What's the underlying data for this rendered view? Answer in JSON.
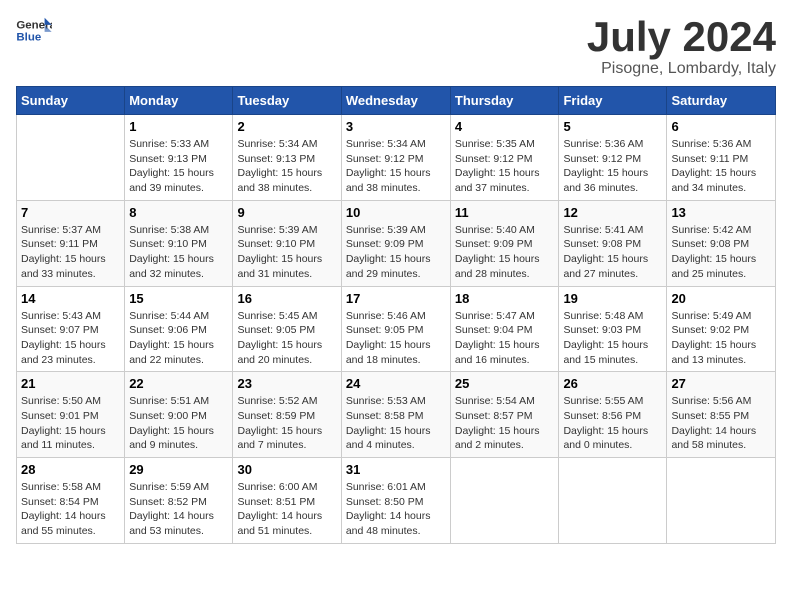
{
  "header": {
    "logo_general": "General",
    "logo_blue": "Blue",
    "month_title": "July 2024",
    "location": "Pisogne, Lombardy, Italy"
  },
  "weekdays": [
    "Sunday",
    "Monday",
    "Tuesday",
    "Wednesday",
    "Thursday",
    "Friday",
    "Saturday"
  ],
  "weeks": [
    [
      {
        "day": "",
        "info": ""
      },
      {
        "day": "1",
        "info": "Sunrise: 5:33 AM\nSunset: 9:13 PM\nDaylight: 15 hours\nand 39 minutes."
      },
      {
        "day": "2",
        "info": "Sunrise: 5:34 AM\nSunset: 9:13 PM\nDaylight: 15 hours\nand 38 minutes."
      },
      {
        "day": "3",
        "info": "Sunrise: 5:34 AM\nSunset: 9:12 PM\nDaylight: 15 hours\nand 38 minutes."
      },
      {
        "day": "4",
        "info": "Sunrise: 5:35 AM\nSunset: 9:12 PM\nDaylight: 15 hours\nand 37 minutes."
      },
      {
        "day": "5",
        "info": "Sunrise: 5:36 AM\nSunset: 9:12 PM\nDaylight: 15 hours\nand 36 minutes."
      },
      {
        "day": "6",
        "info": "Sunrise: 5:36 AM\nSunset: 9:11 PM\nDaylight: 15 hours\nand 34 minutes."
      }
    ],
    [
      {
        "day": "7",
        "info": "Sunrise: 5:37 AM\nSunset: 9:11 PM\nDaylight: 15 hours\nand 33 minutes."
      },
      {
        "day": "8",
        "info": "Sunrise: 5:38 AM\nSunset: 9:10 PM\nDaylight: 15 hours\nand 32 minutes."
      },
      {
        "day": "9",
        "info": "Sunrise: 5:39 AM\nSunset: 9:10 PM\nDaylight: 15 hours\nand 31 minutes."
      },
      {
        "day": "10",
        "info": "Sunrise: 5:39 AM\nSunset: 9:09 PM\nDaylight: 15 hours\nand 29 minutes."
      },
      {
        "day": "11",
        "info": "Sunrise: 5:40 AM\nSunset: 9:09 PM\nDaylight: 15 hours\nand 28 minutes."
      },
      {
        "day": "12",
        "info": "Sunrise: 5:41 AM\nSunset: 9:08 PM\nDaylight: 15 hours\nand 27 minutes."
      },
      {
        "day": "13",
        "info": "Sunrise: 5:42 AM\nSunset: 9:08 PM\nDaylight: 15 hours\nand 25 minutes."
      }
    ],
    [
      {
        "day": "14",
        "info": "Sunrise: 5:43 AM\nSunset: 9:07 PM\nDaylight: 15 hours\nand 23 minutes."
      },
      {
        "day": "15",
        "info": "Sunrise: 5:44 AM\nSunset: 9:06 PM\nDaylight: 15 hours\nand 22 minutes."
      },
      {
        "day": "16",
        "info": "Sunrise: 5:45 AM\nSunset: 9:05 PM\nDaylight: 15 hours\nand 20 minutes."
      },
      {
        "day": "17",
        "info": "Sunrise: 5:46 AM\nSunset: 9:05 PM\nDaylight: 15 hours\nand 18 minutes."
      },
      {
        "day": "18",
        "info": "Sunrise: 5:47 AM\nSunset: 9:04 PM\nDaylight: 15 hours\nand 16 minutes."
      },
      {
        "day": "19",
        "info": "Sunrise: 5:48 AM\nSunset: 9:03 PM\nDaylight: 15 hours\nand 15 minutes."
      },
      {
        "day": "20",
        "info": "Sunrise: 5:49 AM\nSunset: 9:02 PM\nDaylight: 15 hours\nand 13 minutes."
      }
    ],
    [
      {
        "day": "21",
        "info": "Sunrise: 5:50 AM\nSunset: 9:01 PM\nDaylight: 15 hours\nand 11 minutes."
      },
      {
        "day": "22",
        "info": "Sunrise: 5:51 AM\nSunset: 9:00 PM\nDaylight: 15 hours\nand 9 minutes."
      },
      {
        "day": "23",
        "info": "Sunrise: 5:52 AM\nSunset: 8:59 PM\nDaylight: 15 hours\nand 7 minutes."
      },
      {
        "day": "24",
        "info": "Sunrise: 5:53 AM\nSunset: 8:58 PM\nDaylight: 15 hours\nand 4 minutes."
      },
      {
        "day": "25",
        "info": "Sunrise: 5:54 AM\nSunset: 8:57 PM\nDaylight: 15 hours\nand 2 minutes."
      },
      {
        "day": "26",
        "info": "Sunrise: 5:55 AM\nSunset: 8:56 PM\nDaylight: 15 hours\nand 0 minutes."
      },
      {
        "day": "27",
        "info": "Sunrise: 5:56 AM\nSunset: 8:55 PM\nDaylight: 14 hours\nand 58 minutes."
      }
    ],
    [
      {
        "day": "28",
        "info": "Sunrise: 5:58 AM\nSunset: 8:54 PM\nDaylight: 14 hours\nand 55 minutes."
      },
      {
        "day": "29",
        "info": "Sunrise: 5:59 AM\nSunset: 8:52 PM\nDaylight: 14 hours\nand 53 minutes."
      },
      {
        "day": "30",
        "info": "Sunrise: 6:00 AM\nSunset: 8:51 PM\nDaylight: 14 hours\nand 51 minutes."
      },
      {
        "day": "31",
        "info": "Sunrise: 6:01 AM\nSunset: 8:50 PM\nDaylight: 14 hours\nand 48 minutes."
      },
      {
        "day": "",
        "info": ""
      },
      {
        "day": "",
        "info": ""
      },
      {
        "day": "",
        "info": ""
      }
    ]
  ]
}
